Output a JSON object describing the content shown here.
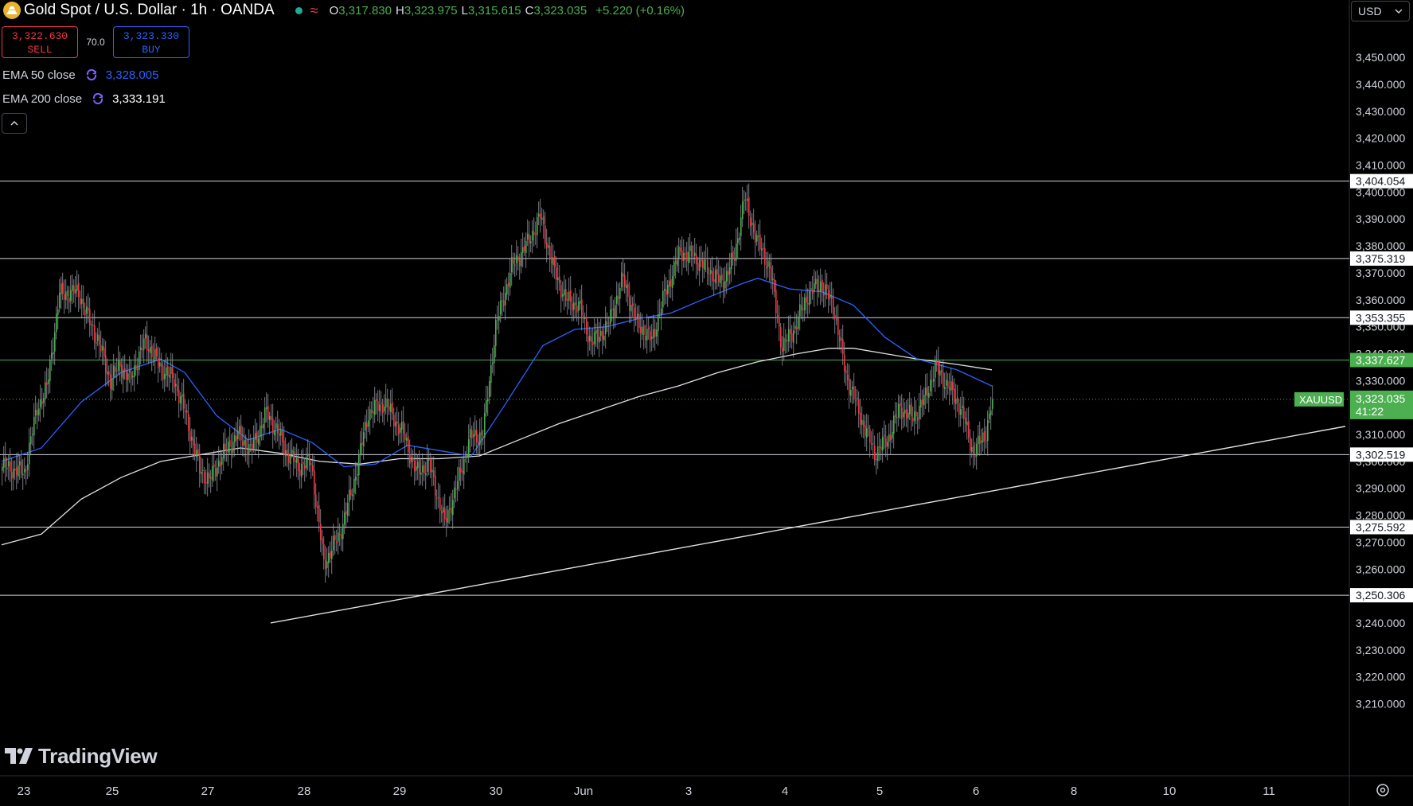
{
  "header": {
    "symbol_title": "Gold Spot / U.S. Dollar · 1h · OANDA",
    "open_label": "O",
    "open": "3,317.830",
    "high_label": "H",
    "high": "3,323.975",
    "low_label": "L",
    "low": "3,315.615",
    "close_label": "C",
    "close": "3,323.035",
    "change": "+5.220 (+0.16%)",
    "market_wave": "≈"
  },
  "trade": {
    "sell_price": "3,322.630",
    "sell_label": "SELL",
    "spread": "70.0",
    "buy_price": "3,323.330",
    "buy_label": "BUY"
  },
  "indicators": [
    {
      "label": "EMA 50 close",
      "value": "3,328.005",
      "color": "#2962ff"
    },
    {
      "label": "EMA 200 close",
      "value": "3,333.191",
      "color": "#ffffff"
    }
  ],
  "currency": "USD",
  "branding": "TradingView",
  "colors": {
    "up": "#4caf50",
    "down": "#f23645",
    "ema50": "#2962ff",
    "ema200": "#e0e0e0",
    "level_line": "#d1d4dc",
    "level_green": "#4caf50",
    "background": "#000000"
  },
  "chart_data": {
    "type": "candlestick",
    "symbol": "XAUUSD",
    "timeframe": "1h",
    "y_range": [
      3208,
      3468
    ],
    "x_ticks": [
      "23",
      "25",
      "27",
      "28",
      "29",
      "30",
      "Jun",
      "3",
      "4",
      "5",
      "6",
      "8",
      "10",
      "11"
    ],
    "y_ticks": [
      "3,210.000",
      "3,220.000",
      "3,230.000",
      "3,240.000",
      "3,250.000",
      "3,260.000",
      "3,270.000",
      "3,280.000",
      "3,290.000",
      "3,300.000",
      "3,310.000",
      "3,320.000",
      "3,330.000",
      "3,340.000",
      "3,350.000",
      "3,360.000",
      "3,370.000",
      "3,380.000",
      "3,390.000",
      "3,400.000",
      "3,410.000",
      "3,420.000",
      "3,430.000",
      "3,440.000",
      "3,450.000"
    ],
    "horizontal_levels": [
      {
        "value": 3404.054,
        "label": "3,404.054",
        "style": "white"
      },
      {
        "value": 3375.319,
        "label": "3,375.319",
        "style": "white"
      },
      {
        "value": 3353.355,
        "label": "3,353.355",
        "style": "white"
      },
      {
        "value": 3337.627,
        "label": "3,337.627",
        "style": "green"
      },
      {
        "value": 3302.519,
        "label": "3,302.519",
        "style": "white"
      },
      {
        "value": 3275.592,
        "label": "3,275.592",
        "style": "white"
      },
      {
        "value": 3250.306,
        "label": "3,250.306",
        "style": "white"
      }
    ],
    "current_price": {
      "symbol": "XAUUSD",
      "value": 3323.035,
      "label": "3,323.035",
      "countdown": "41:22"
    },
    "trendline_prices": [
      3240,
      3313
    ],
    "close_path": [
      [
        0,
        3298
      ],
      [
        14,
        3296
      ],
      [
        22,
        3320
      ],
      [
        28,
        3327
      ],
      [
        36,
        3362
      ],
      [
        48,
        3363
      ],
      [
        52,
        3356
      ],
      [
        60,
        3345
      ],
      [
        68,
        3330
      ],
      [
        74,
        3336
      ],
      [
        80,
        3330
      ],
      [
        90,
        3345
      ],
      [
        98,
        3336
      ],
      [
        108,
        3330
      ],
      [
        114,
        3320
      ],
      [
        124,
        3297
      ],
      [
        130,
        3293
      ],
      [
        138,
        3302
      ],
      [
        148,
        3310
      ],
      [
        156,
        3304
      ],
      [
        166,
        3318
      ],
      [
        172,
        3312
      ],
      [
        178,
        3304
      ],
      [
        186,
        3298
      ],
      [
        194,
        3300
      ],
      [
        202,
        3262
      ],
      [
        212,
        3273
      ],
      [
        220,
        3290
      ],
      [
        230,
        3318
      ],
      [
        240,
        3322
      ],
      [
        252,
        3310
      ],
      [
        260,
        3296
      ],
      [
        268,
        3299
      ],
      [
        278,
        3277
      ],
      [
        286,
        3292
      ],
      [
        294,
        3309
      ],
      [
        302,
        3310
      ],
      [
        310,
        3350
      ],
      [
        320,
        3372
      ],
      [
        330,
        3381
      ],
      [
        338,
        3391
      ],
      [
        346,
        3372
      ],
      [
        354,
        3360
      ],
      [
        362,
        3358
      ],
      [
        370,
        3344
      ],
      [
        380,
        3350
      ],
      [
        390,
        3368
      ],
      [
        398,
        3352
      ],
      [
        408,
        3345
      ],
      [
        416,
        3362
      ],
      [
        426,
        3378
      ],
      [
        434,
        3376
      ],
      [
        442,
        3372
      ],
      [
        452,
        3366
      ],
      [
        460,
        3376
      ],
      [
        466,
        3398
      ],
      [
        474,
        3382
      ],
      [
        482,
        3372
      ],
      [
        490,
        3342
      ],
      [
        498,
        3350
      ],
      [
        506,
        3362
      ],
      [
        514,
        3366
      ],
      [
        522,
        3358
      ],
      [
        530,
        3332
      ],
      [
        540,
        3315
      ],
      [
        548,
        3303
      ],
      [
        556,
        3308
      ],
      [
        564,
        3320
      ],
      [
        572,
        3316
      ],
      [
        580,
        3324
      ],
      [
        586,
        3335
      ],
      [
        594,
        3328
      ],
      [
        602,
        3320
      ],
      [
        610,
        3303
      ],
      [
        618,
        3311
      ],
      [
        622,
        3323
      ]
    ],
    "ema50_path": [
      [
        0,
        3300
      ],
      [
        25,
        3305
      ],
      [
        50,
        3322
      ],
      [
        75,
        3333
      ],
      [
        100,
        3338
      ],
      [
        115,
        3333
      ],
      [
        135,
        3317
      ],
      [
        155,
        3308
      ],
      [
        175,
        3312
      ],
      [
        195,
        3307
      ],
      [
        215,
        3298
      ],
      [
        235,
        3299
      ],
      [
        255,
        3306
      ],
      [
        275,
        3304
      ],
      [
        295,
        3302
      ],
      [
        315,
        3320
      ],
      [
        340,
        3343
      ],
      [
        360,
        3349
      ],
      [
        380,
        3350
      ],
      [
        400,
        3353
      ],
      [
        420,
        3355
      ],
      [
        440,
        3360
      ],
      [
        465,
        3366
      ],
      [
        475,
        3368
      ],
      [
        495,
        3364
      ],
      [
        515,
        3363
      ],
      [
        535,
        3358
      ],
      [
        555,
        3346
      ],
      [
        575,
        3338
      ],
      [
        600,
        3334
      ],
      [
        622,
        3328
      ]
    ],
    "ema200_path": [
      [
        0,
        3269
      ],
      [
        25,
        3273
      ],
      [
        50,
        3286
      ],
      [
        75,
        3294
      ],
      [
        100,
        3300
      ],
      [
        120,
        3302
      ],
      [
        150,
        3305
      ],
      [
        175,
        3303
      ],
      [
        200,
        3300
      ],
      [
        225,
        3299
      ],
      [
        250,
        3301
      ],
      [
        275,
        3301
      ],
      [
        300,
        3302
      ],
      [
        325,
        3308
      ],
      [
        350,
        3314
      ],
      [
        375,
        3319
      ],
      [
        400,
        3324
      ],
      [
        425,
        3328
      ],
      [
        450,
        3333
      ],
      [
        475,
        3337
      ],
      [
        500,
        3340
      ],
      [
        520,
        3342
      ],
      [
        535,
        3342
      ],
      [
        555,
        3340
      ],
      [
        575,
        3338
      ],
      [
        600,
        3336
      ],
      [
        622,
        3334
      ]
    ]
  }
}
